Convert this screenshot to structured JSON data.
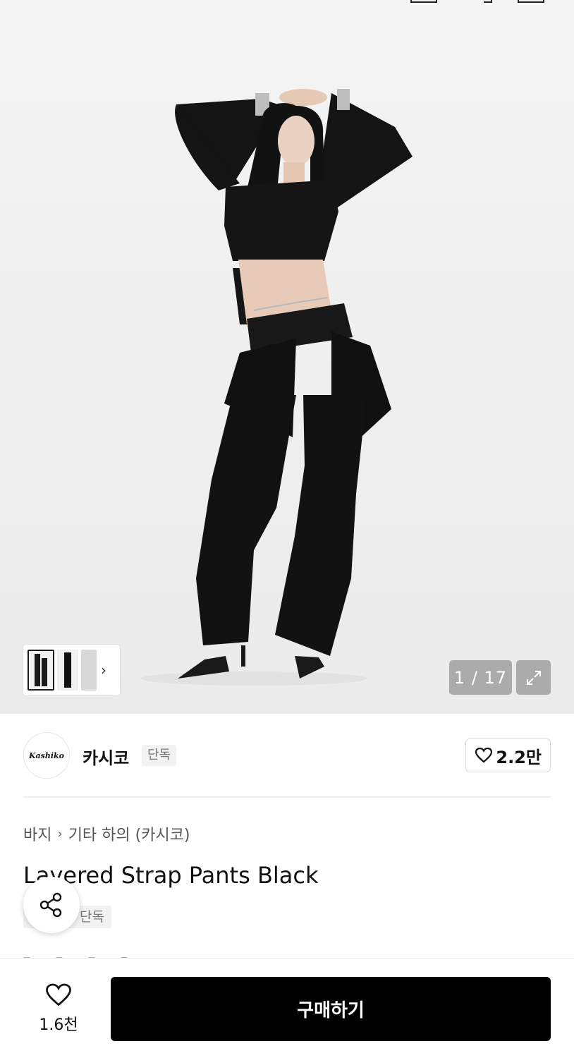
{
  "gallery": {
    "counter": "1 / 17",
    "photo_alt": "Model wearing black cropped top and layered strap pants",
    "thumbnail_count": 3
  },
  "brand": {
    "logo_text": "Kashiko",
    "name": "카시코",
    "badge": "단독",
    "likes": "2.2만"
  },
  "breadcrumb": {
    "category": "바지",
    "subcategory": "기타 하의 (카시코)"
  },
  "product": {
    "title": "Layered Strap Pants Black",
    "tag": "단독"
  },
  "bottom_bar": {
    "wish_count": "1.6천",
    "buy_label": "구매하기"
  },
  "colors": {
    "buy_button": "#000000",
    "badge_bg": "#f2f2f2",
    "counter_bg": "#a0a0a0"
  }
}
